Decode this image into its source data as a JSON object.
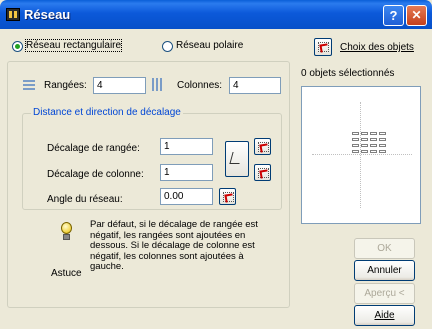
{
  "window": {
    "title": "Réseau",
    "help_glyph": "?",
    "close_glyph": "✕"
  },
  "array_type": {
    "rect_label": "Réseau rectangulaire",
    "polar_label": "Réseau polaire",
    "selected": "rect"
  },
  "select_objects": {
    "button_label": "Choix des objets",
    "status": "0 objets sélectionnés"
  },
  "grid": {
    "rows_label": "Rangées:",
    "rows_value": "4",
    "cols_label": "Colonnes:",
    "cols_value": "4"
  },
  "offset": {
    "group_label": "Distance et direction de décalage",
    "row_offset_label": "Décalage de rangée:",
    "row_offset_value": "1",
    "col_offset_label": "Décalage de colonne:",
    "col_offset_value": "1",
    "angle_label": "Angle du réseau:",
    "angle_value": "0.00"
  },
  "tip": {
    "label": "Astuce",
    "text": "Par défaut, si le décalage de rangée est négatif, les rangées sont ajoutées en dessous. Si le décalage de colonne est négatif, les colonnes sont ajoutées à gauche."
  },
  "buttons": {
    "ok": "OK",
    "cancel": "Annuler",
    "preview": "Aperçu <",
    "help": "Aide"
  },
  "colors": {
    "accent": "#0046d5",
    "dialog_bg": "#ECE9D8",
    "titlebar": "#0A5FD8"
  },
  "icons": {
    "app": "array-app-icon",
    "rows": "rows-icon",
    "cols": "columns-icon",
    "pick": "pick-point-icon",
    "tip": "light-bulb-icon"
  }
}
